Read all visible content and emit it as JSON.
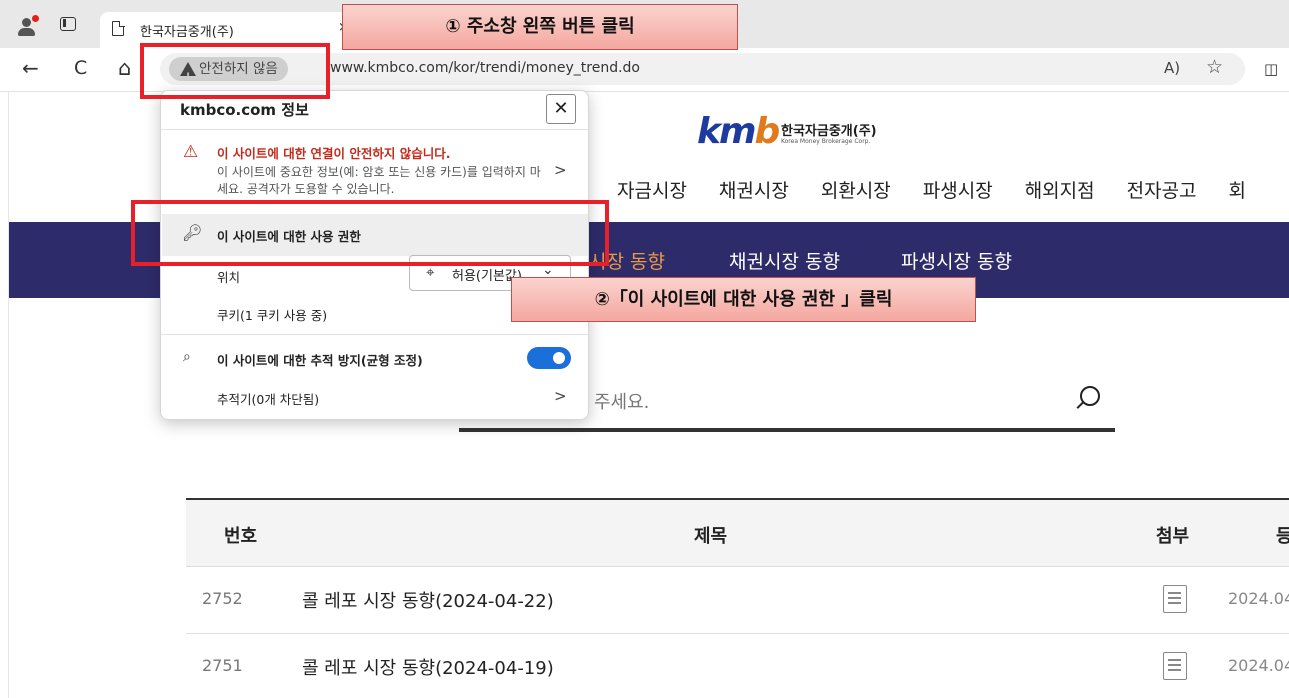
{
  "browser": {
    "tab": {
      "title": "한국자금중개(주)",
      "close_glyph": "×"
    },
    "toolbar": {
      "back_glyph": "←",
      "refresh_glyph": "C",
      "home_glyph": "⌂",
      "security_label": "안전하지 않음",
      "url": "www.kmbco.com/kor/trendi/money_trend.do",
      "read_aloud_glyph": "A)",
      "favorite_glyph": "☆",
      "split_glyph": "◫"
    }
  },
  "site": {
    "logo_text_prefix": "km",
    "logo_text_suffix": "b",
    "logo_ko": "한국자금중개(주)",
    "logo_en": "Korea Money Brokerage Corp.",
    "main_nav": [
      "자금시장",
      "채권시장",
      "외환시장",
      "파생시장",
      "해외지점",
      "전자공고",
      "회"
    ],
    "sub_nav": [
      {
        "label": "시장 동향",
        "active": true
      },
      {
        "label": "채권시장 동향",
        "active": false
      },
      {
        "label": "파생시장 동향",
        "active": false
      }
    ],
    "search_placeholder": "주세요.",
    "table": {
      "headers": {
        "number": "번호",
        "title": "제목",
        "attachment": "첨부",
        "date": "등"
      },
      "rows": [
        {
          "number": "2752",
          "title": "콜 레포 시장 동향(2024-04-22)",
          "date": "2024.04"
        },
        {
          "number": "2751",
          "title": "콜 레포 시장 동향(2024-04-19)",
          "date": "2024.04"
        }
      ]
    }
  },
  "popup": {
    "title": "kmbco.com 정보",
    "close_glyph": "✕",
    "warning_title": "이 사이트에 대한 연결이 안전하지 않습니다.",
    "warning_desc": "이 사이트에 중요한 정보(예: 암호 또는 신용 카드)를 입력하지 마세요. 공격자가 도용할 수 있습니다.",
    "permissions_label": "이 사이트에 대한 사용 권한",
    "location_label": "위치",
    "location_value": "허용(기본값)",
    "cookies_label": "쿠키(1 쿠키 사용 중)",
    "tracking_label": "이 사이트에 대한 추적 방지(균형 조정)",
    "tracking_enabled": true,
    "trackers_label": "추적기(0개 차단됨)",
    "chevron_glyph": ">"
  },
  "annotations": {
    "step1": "① 주소창 왼쪽 버튼 클릭",
    "step2": "②「이 사이트에 대한 사용 권한 」클릭",
    "highlight_color": "#e8202a"
  }
}
